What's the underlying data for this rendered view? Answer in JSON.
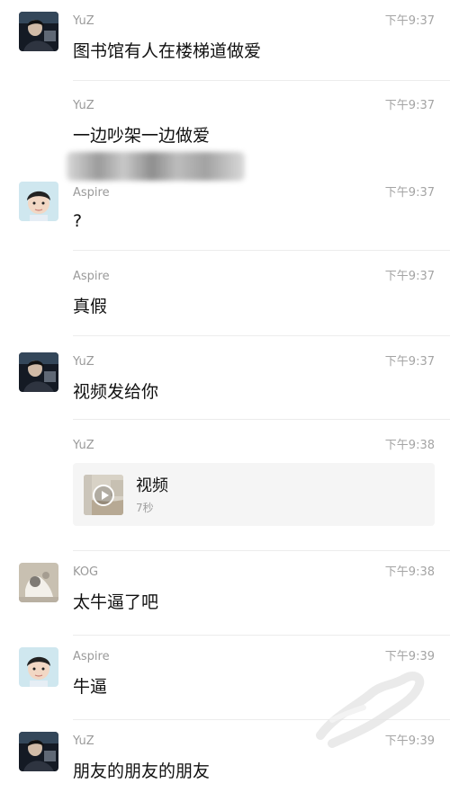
{
  "messages": [
    {
      "sender": "YuZ",
      "time": "下午9:37",
      "text": "图书馆有人在楼梯道做爱",
      "avatar": "yuz-avatar-icon"
    },
    {
      "sender": "YuZ",
      "time": "下午9:37",
      "text": "一边吵架一边做爱"
    },
    {
      "sender": "Aspire",
      "time": "下午9:37",
      "text": "?",
      "avatar": "aspire-avatar-icon"
    },
    {
      "sender": "Aspire",
      "time": "下午9:37",
      "text": "真假"
    },
    {
      "sender": "YuZ",
      "time": "下午9:37",
      "text": "视频发给你",
      "avatar": "yuz-avatar-icon"
    },
    {
      "sender": "YuZ",
      "time": "下午9:38",
      "video": {
        "title": "视频",
        "duration": "7秒",
        "icon": "play-icon"
      }
    },
    {
      "sender": "KOG",
      "time": "下午9:38",
      "text": "太牛逼了吧",
      "avatar": "kog-avatar-icon"
    },
    {
      "sender": "Aspire",
      "time": "下午9:39",
      "text": "牛逼",
      "avatar": "aspire-avatar-icon"
    },
    {
      "sender": "YuZ",
      "time": "下午9:39",
      "text": "朋友的朋友的朋友",
      "avatar": "yuz-avatar-icon"
    }
  ],
  "colors": {
    "background": "#ffffff",
    "meta_text": "#9a9a9a",
    "divider": "#ececec",
    "video_card_bg": "#f5f5f5"
  }
}
